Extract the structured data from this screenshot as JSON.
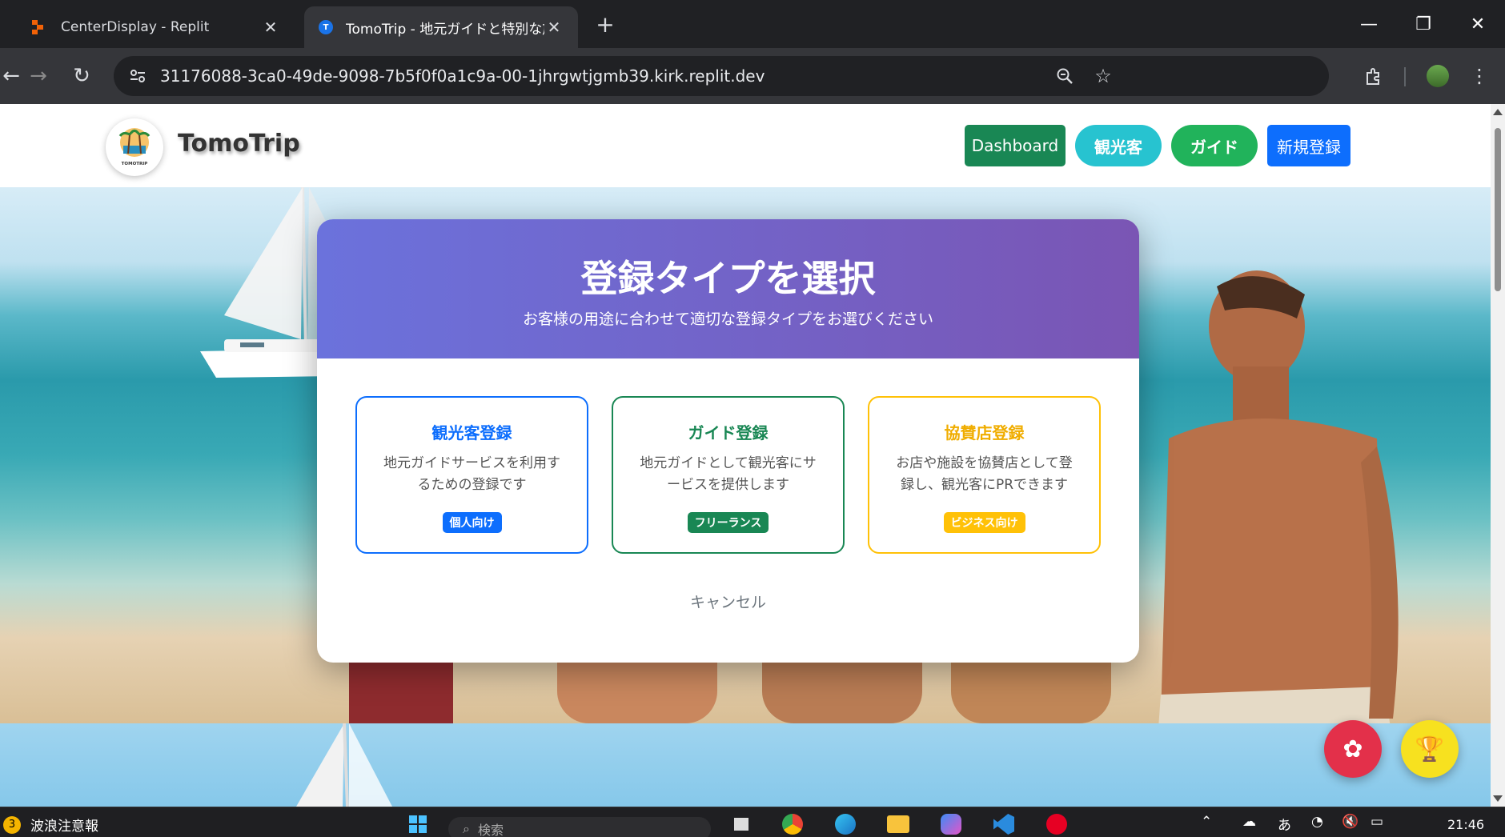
{
  "browser": {
    "tabs": [
      {
        "title": "CenterDisplay - Replit",
        "active": false
      },
      {
        "title": "TomoTrip - 地元ガイドと特別な旅",
        "active": true
      }
    ],
    "url": "31176088-3ca0-49de-9098-7b5f0f0a1c9a-00-1jhrgwtjgmb39.kirk.replit.dev"
  },
  "site": {
    "brand": "TomoTrip",
    "logo_text": "TOMOTRIP",
    "nav": {
      "dashboard": "Dashboard",
      "tourist": "観光客",
      "guide": "ガイド",
      "register": "新規登録"
    }
  },
  "modal": {
    "title": "登録タイプを選択",
    "subtitle": "お客様の用途に合わせて適切な登録タイプをお選びください",
    "cards": [
      {
        "title": "観光客登録",
        "desc": "地元ガイドサービスを利用するための登録です",
        "badge": "個人向け"
      },
      {
        "title": "ガイド登録",
        "desc": "地元ガイドとして観光客にサービスを提供します",
        "badge": "フリーランス"
      },
      {
        "title": "協賛店登録",
        "desc": "お店や施設を協賛店として登録し、観光客にPRできます",
        "badge": "ビジネス向け"
      }
    ],
    "cancel": "キャンセル"
  },
  "taskbar": {
    "weather_badge": "3",
    "weather": "波浪注意報",
    "search_placeholder": "検索",
    "ime": "あ",
    "time": "21:46"
  },
  "colors": {
    "primary": "#0d6efd",
    "success": "#198754",
    "warning": "#ffc107",
    "modal_gradient_start": "#6b72dc",
    "modal_gradient_end": "#7a55b4"
  }
}
